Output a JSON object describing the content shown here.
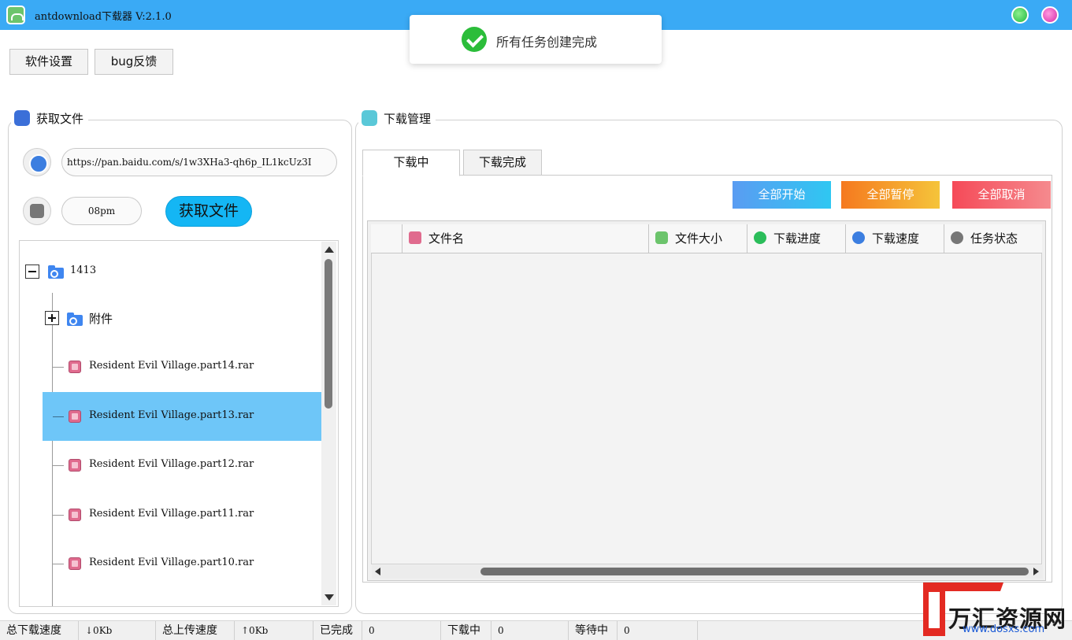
{
  "window": {
    "title": "antdownload下载器  V:2.1.0"
  },
  "toast": {
    "message": "所有任务创建完成"
  },
  "toolbar": {
    "settings_label": "软件设置",
    "feedback_label": "bug反馈"
  },
  "left_panel": {
    "title": "获取文件",
    "url_value": "https://pan.baidu.com/s/1w3XHa3-qh6p_IL1kcUz3I",
    "code_value": "08pm",
    "fetch_label": "获取文件",
    "tree": {
      "root": "1413",
      "folder": "附件",
      "files": [
        "Resident Evil Village.part14.rar",
        "Resident Evil Village.part13.rar",
        "Resident Evil Village.part12.rar",
        "Resident Evil Village.part11.rar",
        "Resident Evil Village.part10.rar"
      ],
      "selected_index": 1
    }
  },
  "right_panel": {
    "title": "下载管理",
    "tabs": [
      "下载中",
      "下载完成"
    ],
    "active_tab": 0,
    "actions": {
      "start_all": "全部开始",
      "pause_all": "全部暂停",
      "cancel_all": "全部取消"
    },
    "columns": [
      "文件名",
      "文件大小",
      "下载进度",
      "下载速度",
      "任务状态"
    ]
  },
  "status_bar": {
    "download_speed_label": "总下载速度",
    "download_speed_value": "↓0Kb",
    "upload_speed_label": "总上传速度",
    "upload_speed_value": "↑0Kb",
    "completed_label": "已完成",
    "completed_value": "0",
    "downloading_label": "下载中",
    "downloading_value": "0",
    "waiting_label": "等待中",
    "waiting_value": "0"
  },
  "watermark": {
    "brand": "万汇资源网",
    "url": "www.dosxs.com"
  },
  "colors": {
    "titlebar": "#3aaaf5",
    "fetch_button": "#14b6f4",
    "start_all": "#4aa3f5",
    "pause_all": "#f59a1f",
    "cancel_all": "#f55a62",
    "selected_row": "#6ec6f8"
  }
}
